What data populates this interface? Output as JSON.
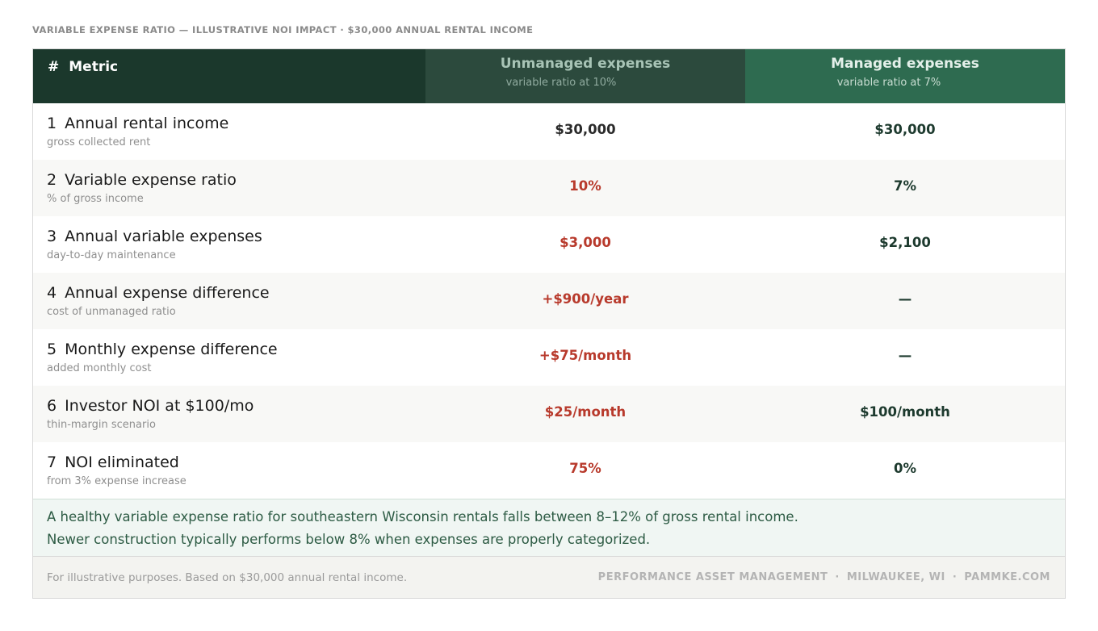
{
  "caption": "VARIABLE EXPENSE RATIO — ILLUSTRATIVE NOI IMPACT · $30,000 ANNUAL RENTAL INCOME",
  "header": {
    "hash": "#",
    "metric": "Metric",
    "unmanaged_title": "Unmanaged expenses",
    "unmanaged_sub": "variable ratio at 10%",
    "managed_title": "Managed expenses",
    "managed_sub": "variable ratio at 7%"
  },
  "rows": [
    {
      "num": "1",
      "label": "Annual rental income",
      "sub": "gross collected rent",
      "unmanaged": "$30,000",
      "managed": "$30,000"
    },
    {
      "num": "2",
      "label": "Variable expense ratio",
      "sub": "% of gross income",
      "unmanaged": "10%",
      "managed": "7%"
    },
    {
      "num": "3",
      "label": "Annual variable expenses",
      "sub": "day-to-day maintenance",
      "unmanaged": "$3,000",
      "managed": "$2,100"
    },
    {
      "num": "4",
      "label": "Annual expense difference",
      "sub": "cost of unmanaged ratio",
      "unmanaged": "+$900/year",
      "managed": "—"
    },
    {
      "num": "5",
      "label": "Monthly expense difference",
      "sub": "added monthly cost",
      "unmanaged": "+$75/month",
      "managed": "—"
    },
    {
      "num": "6",
      "label": "Investor NOI at $100/mo",
      "sub": "thin-margin scenario",
      "unmanaged": "$25/month",
      "managed": "$100/month"
    },
    {
      "num": "7",
      "label": "NOI eliminated",
      "sub": "from 3% expense increase",
      "unmanaged": "75%",
      "managed": "0%"
    }
  ],
  "note": {
    "line1": "A healthy variable expense ratio for southeastern Wisconsin rentals falls between 8–12% of gross rental income.",
    "line2": "Newer construction typically performs below 8% when expenses are properly categorized."
  },
  "footer": {
    "left": "For illustrative purposes. Based on $30,000 annual rental income.",
    "brand": "PERFORMANCE ASSET MANAGEMENT",
    "location": "MILWAUKEE, WI",
    "site": "PAMMKE.COM",
    "separator": "·"
  },
  "colors": {
    "header_dark": "#1b382c",
    "header_unmanaged": "#2c4a3d",
    "header_managed": "#2e6b50",
    "negative_value": "#b83a2c",
    "positive_value": "#1d3a2e",
    "note_text": "#2d5b44"
  }
}
